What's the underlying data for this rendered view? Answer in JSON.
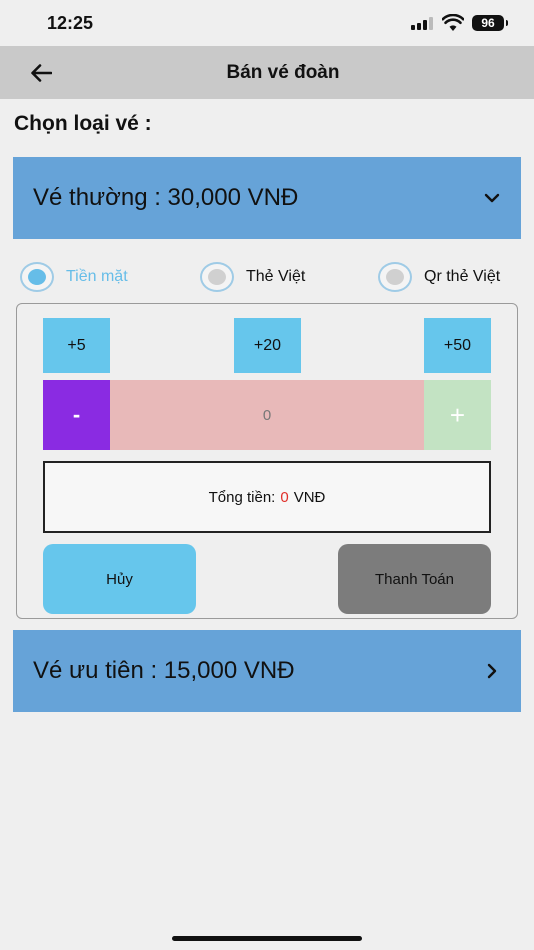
{
  "status": {
    "time": "12:25",
    "battery": "96"
  },
  "header": {
    "title": "Bán vé đoàn"
  },
  "section": {
    "label": "Chọn loại vé :"
  },
  "tickets": {
    "normal": "Vé thường : 30,000 VNĐ",
    "priority": "Vé ưu tiên : 15,000 VNĐ"
  },
  "payment_methods": [
    {
      "label": "Tiền mặt",
      "selected": true
    },
    {
      "label": "Thẻ Việt",
      "selected": false
    },
    {
      "label": "Qr thẻ Việt",
      "selected": false
    }
  ],
  "quick_add": [
    "+5",
    "+20",
    "+50"
  ],
  "stepper": {
    "minus": "-",
    "value": "0",
    "plus": "+"
  },
  "total": {
    "label": "Tổng tiền:",
    "amount": "0",
    "currency": "VNĐ"
  },
  "actions": {
    "cancel": "Hủy",
    "pay": "Thanh Toán"
  },
  "colors": {
    "accent": "#66c6ec",
    "bar": "#66a3d8",
    "minus": "#8a2be2",
    "amount": "#e0302a"
  }
}
